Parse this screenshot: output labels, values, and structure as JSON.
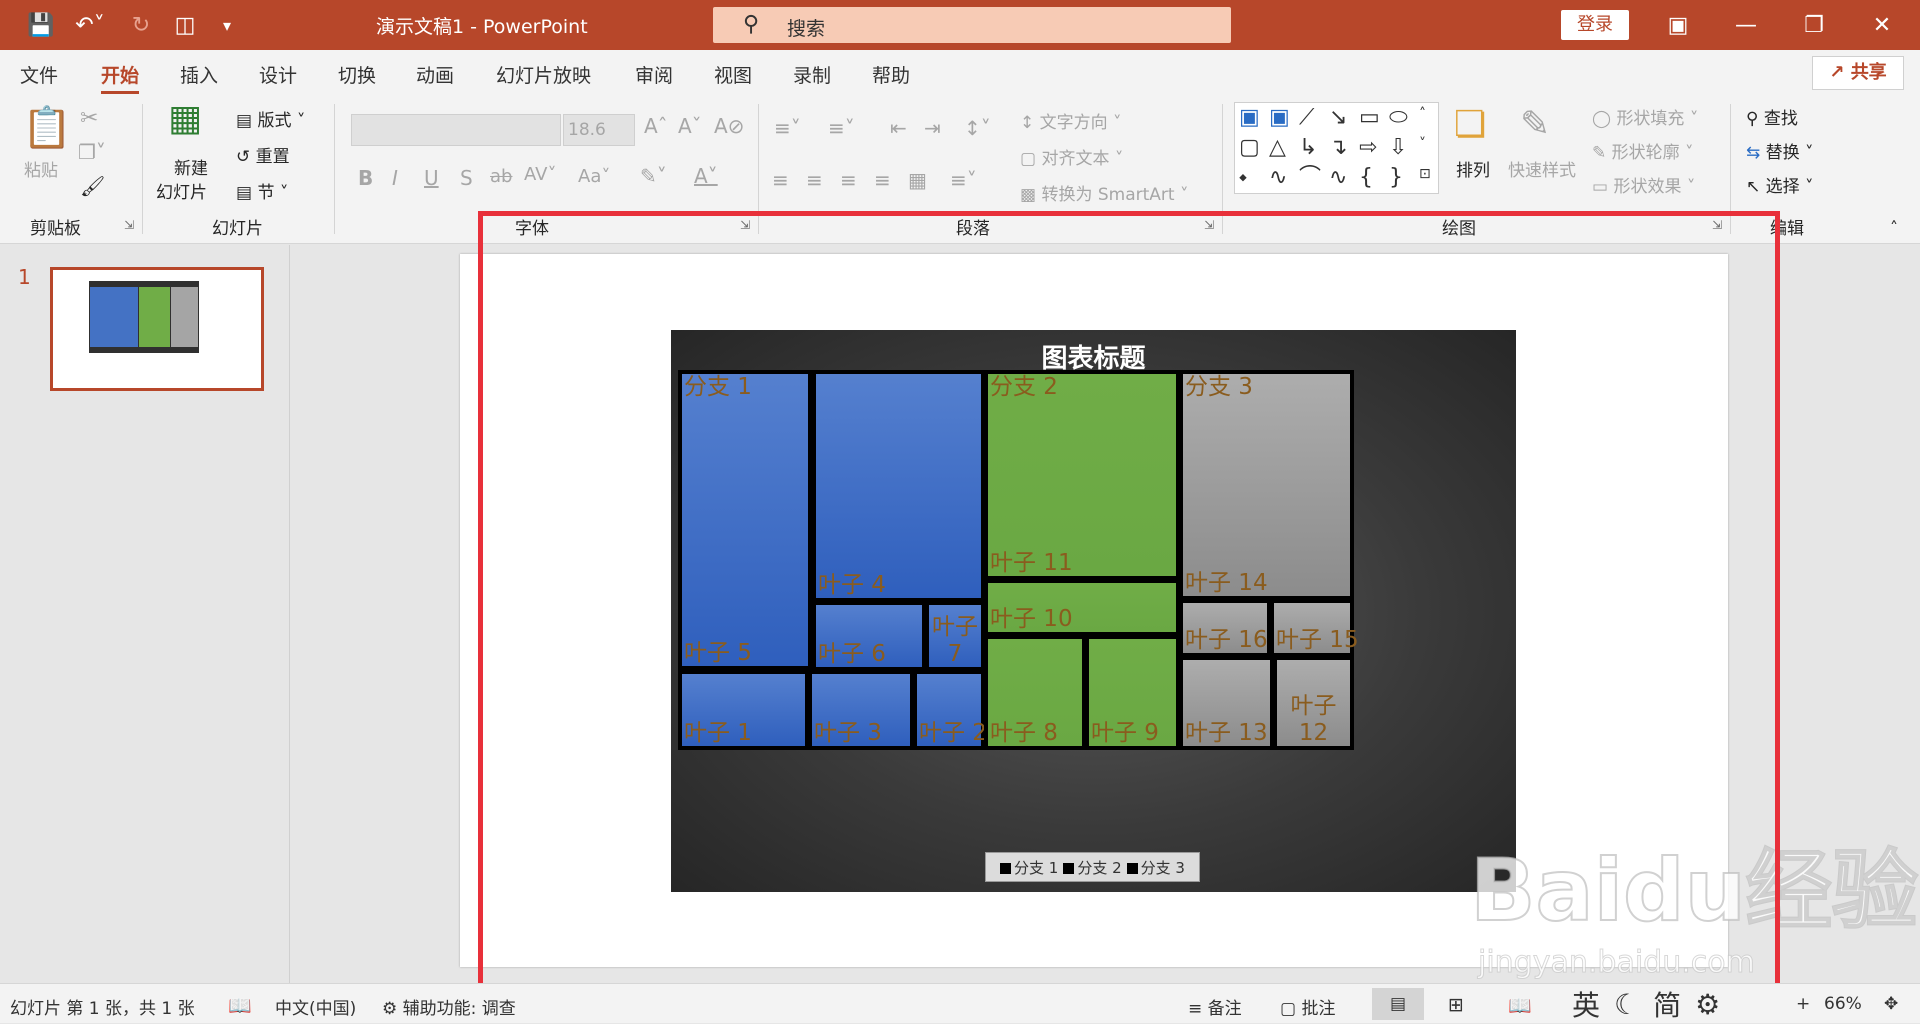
{
  "titlebar": {
    "doc_title": "演示文稿1 - PowerPoint",
    "search_placeholder": "搜索",
    "login_label": "登录"
  },
  "menu": {
    "tabs": [
      "文件",
      "开始",
      "插入",
      "设计",
      "切换",
      "动画",
      "幻灯片放映",
      "审阅",
      "视图",
      "录制",
      "帮助"
    ],
    "share_label": "共享"
  },
  "ribbon": {
    "clipboard": {
      "paste": "粘贴",
      "group": "剪贴板"
    },
    "slides": {
      "new_slide_1": "新建",
      "new_slide_2": "幻灯片",
      "layout": "版式",
      "reset": "重置",
      "section": "节",
      "group": "幻灯片"
    },
    "font": {
      "size": "18.6",
      "group": "字体"
    },
    "paragraph": {
      "text_direction": "文字方向",
      "align_text": "对齐文本",
      "smartart": "转换为 SmartArt",
      "group": "段落"
    },
    "drawing": {
      "arrange": "排列",
      "quick_styles": "快速样式",
      "shape_fill": "形状填充",
      "shape_outline": "形状轮廓",
      "shape_effects": "形状效果",
      "group": "绘图"
    },
    "editing": {
      "find": "查找",
      "replace": "替换",
      "select": "选择",
      "group": "编辑"
    }
  },
  "slide_pane": {
    "slide_number": "1"
  },
  "chart_data": {
    "type": "treemap",
    "title": "图表标题",
    "series": [
      {
        "name": "分支 1",
        "color": "#4472c4",
        "leaves": [
          "叶子 5",
          "叶子 4",
          "叶子 6",
          "叶子 7",
          "叶子 1",
          "叶子 3",
          "叶子 2"
        ]
      },
      {
        "name": "分支 2",
        "color": "#70ad47",
        "leaves": [
          "叶子 11",
          "叶子 10",
          "叶子 8",
          "叶子 9"
        ]
      },
      {
        "name": "分支 3",
        "color": "#a5a5a5",
        "leaves": [
          "叶子 14",
          "叶子 16",
          "叶子 15",
          "叶子 13",
          "叶子 12"
        ]
      }
    ],
    "legend": [
      "分支 1",
      "分支 2",
      "分支 3"
    ],
    "legend_position": "bottom"
  },
  "statusbar": {
    "slide_info": "幻灯片 第 1 张，共 1 张",
    "language": "中文(中国)",
    "accessibility": "辅助功能: 调查",
    "notes": "备注",
    "comments": "批注",
    "zoom": "66%"
  },
  "ime": {
    "lang": "英",
    "script": "简"
  },
  "watermark": {
    "big": "Baidu经验",
    "small": "jingyan.baidu.com"
  },
  "colors": {
    "accent": "#b7472a",
    "frame": "#e8303a",
    "blue": "#4472c4",
    "green": "#70ad47",
    "gray": "#a5a5a5"
  }
}
